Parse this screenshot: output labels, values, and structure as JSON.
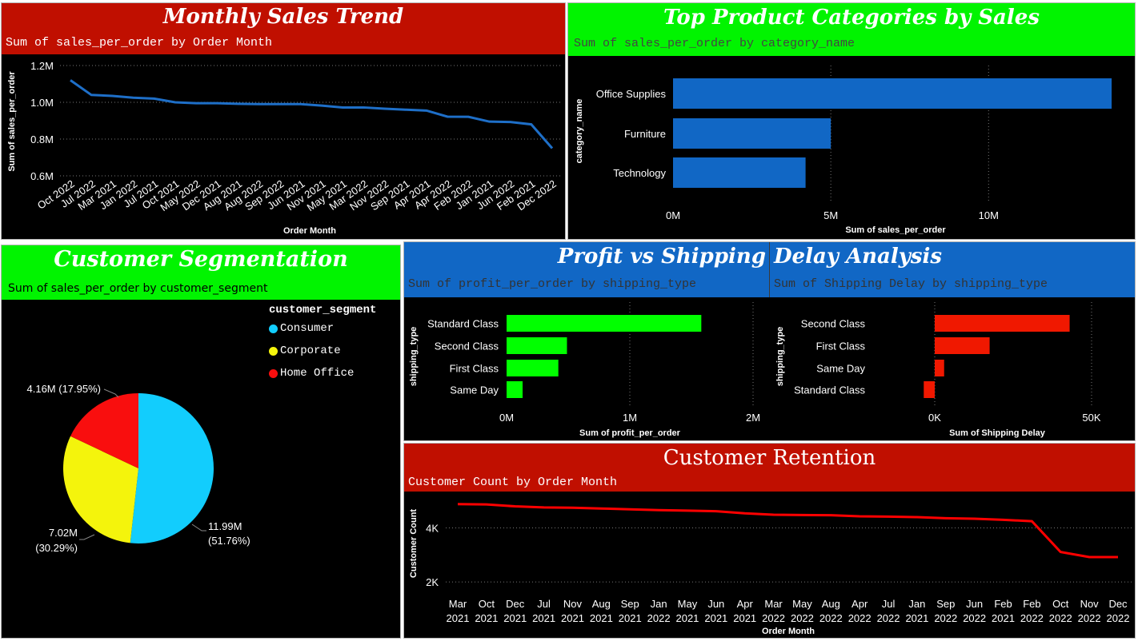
{
  "colors": {
    "red": "#c00f00",
    "green": "#01f400",
    "blue": "#1167c5",
    "lineBlue": "#1e6fc8",
    "barRed": "#f01800",
    "barGreen": "#01ff00"
  },
  "panels": {
    "monthly_sales": {
      "title": "Monthly Sales Trend",
      "subtitle": "Sum of sales_per_order by Order Month"
    },
    "top_categories": {
      "title": "Top Product Categories by Sales",
      "subtitle": "Sum of sales_per_order by category_name"
    },
    "segmentation": {
      "title": "Customer Segmentation",
      "subtitle": "Sum of sales_per_order by customer_segment",
      "legend_title": "customer_segment"
    },
    "profit_shipping": {
      "title_left": "Profit vs Shipping",
      "title_right": "Delay Analysis",
      "subtitle_left": "Sum of profit_per_order by shipping_type",
      "subtitle_right": "Sum of Shipping Delay by shipping_type"
    },
    "retention": {
      "title": "Customer Retention",
      "subtitle": "Customer Count by Order Month"
    }
  },
  "chart_data": [
    {
      "id": "monthly_sales",
      "type": "line",
      "xlabel": "Order Month",
      "ylabel": "Sum of sales_per_order",
      "x": [
        "Oct 2022",
        "Jul 2022",
        "Mar 2021",
        "Jan 2022",
        "Jul 2021",
        "Oct 2021",
        "May 2022",
        "Dec 2021",
        "Aug 2021",
        "Aug 2022",
        "Sep 2022",
        "Jun 2021",
        "Nov 2021",
        "May 2021",
        "Mar 2022",
        "Nov 2022",
        "Sep 2021",
        "Apr 2021",
        "Apr 2022",
        "Feb 2022",
        "Jan 2021",
        "Jun 2022",
        "Feb 2021",
        "Dec 2022"
      ],
      "values": [
        1.12,
        1.04,
        1.035,
        1.025,
        1.02,
        1.0,
        0.995,
        0.995,
        0.992,
        0.99,
        0.99,
        0.99,
        0.982,
        0.972,
        0.972,
        0.965,
        0.96,
        0.955,
        0.922,
        0.921,
        0.895,
        0.893,
        0.88,
        0.75
      ],
      "yticks": [
        "0.6M",
        "0.8M",
        "1.0M",
        "1.2M"
      ],
      "ylim": [
        0.6,
        1.2
      ],
      "unit": "M",
      "grid": true
    },
    {
      "id": "top_categories",
      "type": "bar",
      "orientation": "horizontal",
      "xlabel": "Sum of sales_per_order",
      "ylabel": "category_name",
      "categories": [
        "Office Supplies",
        "Furniture",
        "Technology"
      ],
      "values": [
        13.9,
        5.0,
        4.2
      ],
      "xticks": [
        "0M",
        "5M",
        "10M"
      ],
      "xlim": [
        0,
        14
      ],
      "unit": "M",
      "grid": true
    },
    {
      "id": "segmentation",
      "type": "pie",
      "categories": [
        "Consumer",
        "Corporate",
        "Home Office"
      ],
      "values": [
        11.99,
        7.02,
        4.16
      ],
      "labels": [
        "11.99M (51.76%)",
        "7.02M (30.29%)",
        "4.16M (17.95%)"
      ],
      "colors": [
        "#12cdfd",
        "#f4f40c",
        "#f90e0e"
      ],
      "legend": "right"
    },
    {
      "id": "profit",
      "type": "bar",
      "orientation": "horizontal",
      "xlabel": "Sum of profit_per_order",
      "ylabel": "shipping_type",
      "categories": [
        "Standard Class",
        "Second Class",
        "First Class",
        "Same Day"
      ],
      "values": [
        1.58,
        0.49,
        0.42,
        0.13
      ],
      "xticks": [
        "0M",
        "1M",
        "2M"
      ],
      "xlim": [
        0,
        2
      ],
      "unit": "M",
      "grid": true
    },
    {
      "id": "delay",
      "type": "bar",
      "orientation": "horizontal",
      "xlabel": "Sum of Shipping Delay",
      "ylabel": "shipping_type",
      "categories": [
        "Second Class",
        "First Class",
        "Same Day",
        "Standard Class"
      ],
      "values": [
        43,
        17.5,
        3,
        -3.5
      ],
      "xticks": [
        "0K",
        "50K"
      ],
      "xlim": [
        -4,
        50
      ],
      "unit": "K",
      "grid": true
    },
    {
      "id": "retention",
      "type": "line",
      "xlabel": "Order Month",
      "ylabel": "Customer Count",
      "x": [
        "Mar 2021",
        "Oct 2021",
        "Dec 2021",
        "Jul 2021",
        "Nov 2021",
        "Aug 2021",
        "Sep 2021",
        "Jan 2022",
        "May 2021",
        "Jun 2021",
        "Apr 2021",
        "Mar 2022",
        "May 2022",
        "Aug 2022",
        "Apr 2022",
        "Jul 2022",
        "Jan 2021",
        "Sep 2022",
        "Jun 2022",
        "Feb 2021",
        "Feb 2022",
        "Oct 2022",
        "Nov 2022",
        "Dec 2022"
      ],
      "values": [
        4880,
        4870,
        4800,
        4760,
        4750,
        4720,
        4690,
        4660,
        4640,
        4620,
        4540,
        4490,
        4480,
        4470,
        4430,
        4420,
        4400,
        4360,
        4340,
        4300,
        4250,
        3110,
        2920,
        2920
      ],
      "yticks": [
        "2K",
        "4K"
      ],
      "ylim": [
        1500,
        5200
      ],
      "grid": true
    }
  ]
}
